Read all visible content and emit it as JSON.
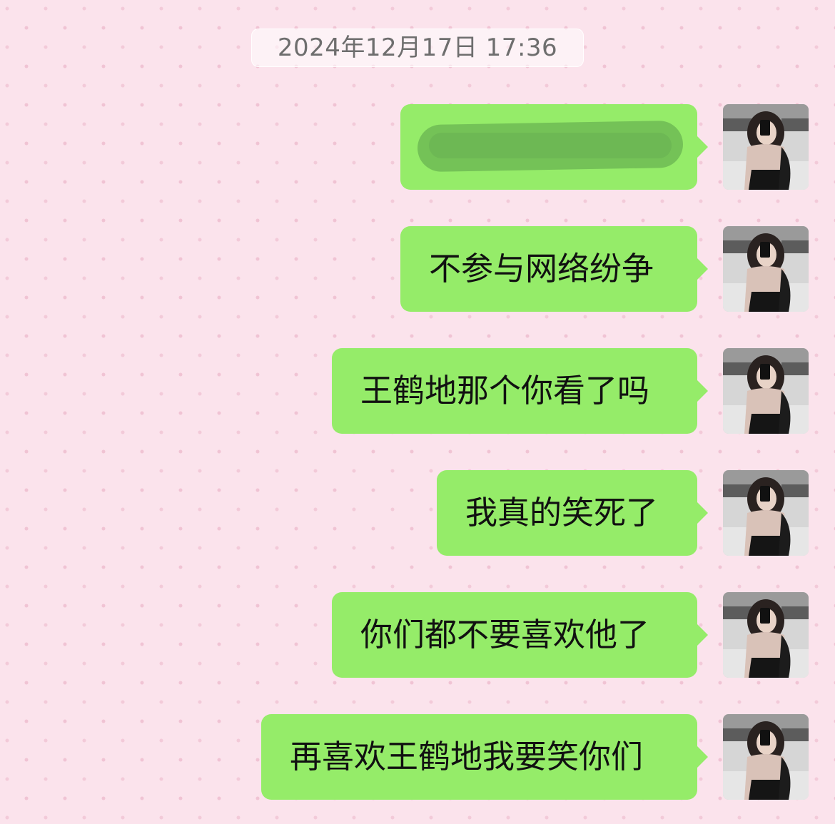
{
  "chat": {
    "timestamp": "2024年12月17日 17:36",
    "messages": [
      {
        "text": "",
        "redacted": true
      },
      {
        "text": "不参与网络纷争"
      },
      {
        "text": "王鹤地那个你看了吗"
      },
      {
        "text": "我真的笑死了"
      },
      {
        "text": "你们都不要喜欢他了"
      },
      {
        "text": "再喜欢王鹤地我要笑你们"
      }
    ]
  },
  "colors": {
    "background": "#fbe3ec",
    "outgoing_bubble": "#95ec69",
    "timestamp_text": "#6e6e6e"
  },
  "icons": {
    "avatar": "user-avatar-photo"
  }
}
